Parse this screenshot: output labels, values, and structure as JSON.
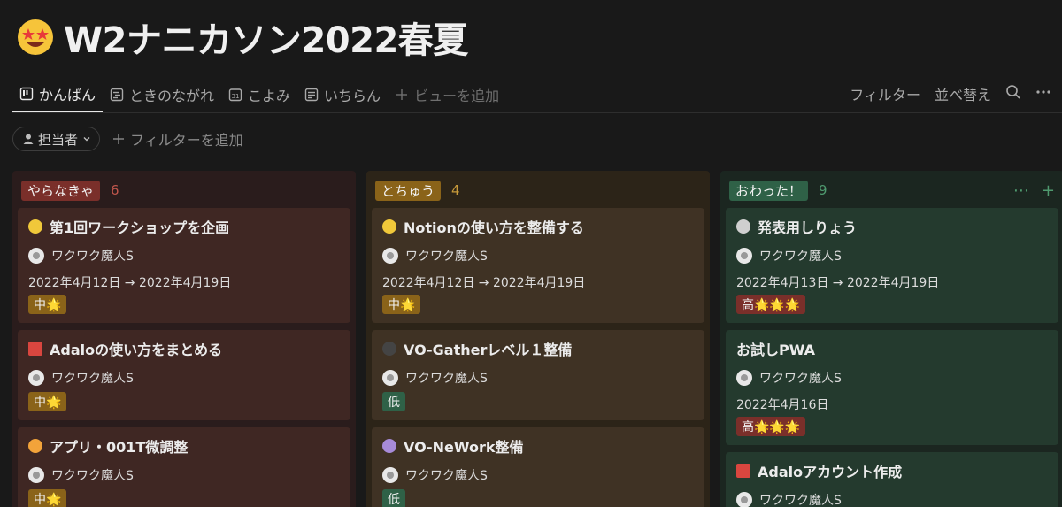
{
  "page": {
    "title": "W2ナニカソン2022春夏",
    "title_icon": "star-struck-emoji-icon"
  },
  "tabs": [
    {
      "label": "かんばん",
      "icon": "board-icon",
      "active": true
    },
    {
      "label": "ときのながれ",
      "icon": "timeline-icon"
    },
    {
      "label": "こよみ",
      "icon": "calendar-icon"
    },
    {
      "label": "いちらん",
      "icon": "list-icon"
    },
    {
      "label": "ビューを追加",
      "icon": "plus-icon"
    }
  ],
  "toolbar": {
    "filter": "フィルター",
    "sort": "並べ替え",
    "search_icon": "search-icon",
    "more_icon": "more-icon"
  },
  "filters": {
    "assignee_chip": "担当者",
    "add_filter": "フィルターを追加"
  },
  "columns": [
    {
      "label": "やらなきゃ",
      "count": "6",
      "label_color": "#7a2f2a",
      "count_color": "#c0564c",
      "cards": [
        {
          "title": "第1回ワークショップを企画",
          "icon_color": "#f0c83a",
          "assignee": "ワクワク魔人S",
          "date": "2022年4月12日 → 2022年4月19日",
          "tag": "中🌟"
        },
        {
          "title": "Adaloの使い方をまとめる",
          "icon_color": "#d9463f",
          "assignee": "ワクワク魔人S",
          "tag": "中🌟"
        },
        {
          "title": "アプリ・001T微調整",
          "icon_color": "#f2a33a",
          "assignee": "ワクワク魔人S",
          "tag": "中🌟"
        }
      ]
    },
    {
      "label": "とちゅう",
      "count": "4",
      "label_color": "#8a6319",
      "count_color": "#c89a3a",
      "cards": [
        {
          "title": "Notionの使い方を整備する",
          "icon_color": "#f0c83a",
          "assignee": "ワクワク魔人S",
          "date": "2022年4月12日 → 2022年4月19日",
          "tag": "中🌟"
        },
        {
          "title": "VO-Gatherレベル１整備",
          "icon_color": "#444444",
          "assignee": "ワクワク魔人S",
          "tag": "低"
        },
        {
          "title": "VO-NeWork整備",
          "icon_color": "#a78bd8",
          "assignee": "ワクワク魔人S",
          "tag": "低"
        }
      ]
    },
    {
      "label": "おわった！",
      "count": "9",
      "label_color": "#2f6147",
      "count_color": "#4f9a6f",
      "cards": [
        {
          "title": "発表用しりょう",
          "icon_color": "#cfcfcf",
          "assignee": "ワクワク魔人S",
          "date": "2022年4月13日 → 2022年4月19日",
          "tag": "高🌟🌟🌟"
        },
        {
          "title": "お試しPWA",
          "assignee": "ワクワク魔人S",
          "date": "2022年4月16日",
          "tag": "高🌟🌟🌟"
        },
        {
          "title": "Adaloアカウント作成",
          "icon_color": "#d9463f",
          "assignee": "ワクワク魔人S"
        }
      ]
    }
  ]
}
